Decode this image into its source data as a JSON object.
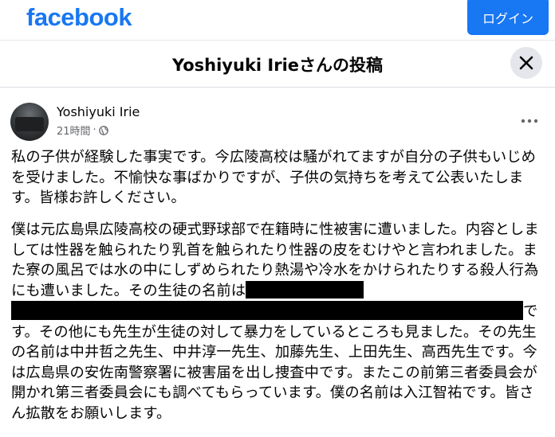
{
  "topbar": {
    "logo_text": "facebook",
    "login_label": "ログイン",
    "brand_color": "#1877f2"
  },
  "dialog": {
    "title": "Yoshiyuki Irieさんの投稿",
    "close_icon": "close-icon"
  },
  "post": {
    "author": "Yoshiyuki Irie",
    "timestamp": "21時間",
    "separator": "·",
    "audience_icon": "globe-icon",
    "more_icon": "more-options-icon",
    "paragraph_1": "私の子供が経験した事実です。今広陵高校は騒がれてますが自分の子供もいじめを受けました。不愉快な事ばかりですが、子供の気持ちを考えて公表いたします。皆様お許しください。",
    "paragraph_2": "僕は元広島県広陵高校の硬式野球部で在籍時に性被害に遭いました。内容としましては性器を触られたり乳首を触られたり性器の皮をむけやと言われました。また寮の風呂では水の中にしずめられたり熱湯や冷水をかけられたりする殺人行為にも遭いました。その生徒の名前は",
    "paragraph_2_tail": "です。その他にも先生が生徒の対して暴力をしているところも見ました。その先生の名前は中井哲之先生、中井淳一先生、加藤先生、上田先生、高西先生です。今は広島県の安佐南警察署に被害届を出し捜査中です。またこの前第三者委員会が開かれ第三者委員会にも調べてもらっています。僕の名前は入江智祐です。皆さん拡散をお願いします。"
  }
}
